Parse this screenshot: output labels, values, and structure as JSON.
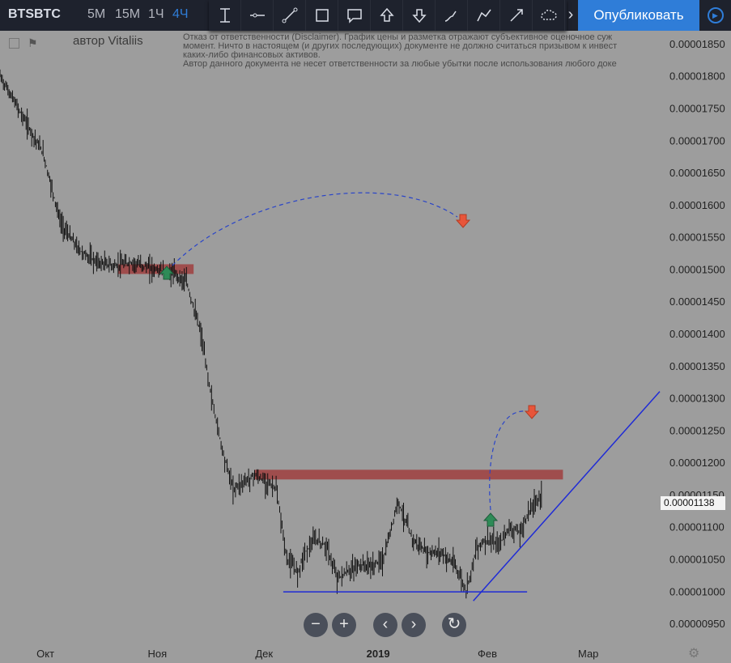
{
  "toolbar": {
    "symbol": "BTSBTC",
    "timeframes": [
      "5М",
      "15М",
      "1Ч",
      "4Ч"
    ],
    "active_timeframe": "4Ч",
    "publish_label": "Опубликовать",
    "more_label": "›"
  },
  "drawing_tools": [
    "text-cursor-icon",
    "horizontal-line-icon",
    "trend-line-icon",
    "rectangle-icon",
    "callout-icon",
    "arrow-up-icon",
    "arrow-down-icon",
    "brush-icon",
    "path-icon",
    "arrow-line-icon"
  ],
  "chart": {
    "author": "автор Vitaliis",
    "disclaimer": [
      "Отказ от ответственности (Disclaimer). График цены и разметка отражают субъективное оценочное суж",
      "момент. Ничто в настоящем (и других последующих) документе не должно считаться призывом к инвест",
      "каких-либо финансовых активов.",
      "Автор данного документа не несет ответственности за любые убытки после использования любого доке"
    ],
    "price_label": "0.00001138"
  },
  "nav_buttons": [
    "−",
    "+",
    "‹",
    "›",
    "↻"
  ],
  "colors": {
    "background": "#9d9d9d",
    "toolbar": "#1e222d",
    "accent": "#2f7dd8",
    "zone": "#a03a3a",
    "trendline": "#1f2bd6",
    "arrow_up": "#2e8b57",
    "arrow_down": "#e8553a"
  },
  "chart_data": {
    "type": "line",
    "yticks": [
      "0.00001850",
      "0.00001800",
      "0.00001750",
      "0.00001700",
      "0.00001650",
      "0.00001600",
      "0.00001550",
      "0.00001500",
      "0.00001450",
      "0.00001400",
      "0.00001350",
      "0.00001300",
      "0.00001250",
      "0.00001200",
      "0.00001150",
      "0.00001100",
      "0.00001050",
      "0.00001000",
      "0.00000950"
    ],
    "ylim": [
      9.25e-06,
      1.87e-05
    ],
    "x_labels": [
      "Окт",
      "Ноя",
      "Дек",
      "2019",
      "Фев",
      "Мар"
    ],
    "x_label_dates": [
      "2018-10-01",
      "2018-11-01",
      "2018-12-01",
      "2019-01-01",
      "2019-02-01",
      "2019-03-01"
    ],
    "xlim": [
      "2018-09-19",
      "2019-03-22"
    ],
    "series": [
      {
        "x": [
          "2018-09-19",
          "2018-09-25",
          "2018-10-01",
          "2018-10-06",
          "2018-10-11",
          "2018-10-16",
          "2018-10-21",
          "2018-10-26",
          "2018-11-01",
          "2018-11-06",
          "2018-11-10",
          "2018-11-14",
          "2018-11-17",
          "2018-11-20",
          "2018-11-23",
          "2018-11-26",
          "2018-11-29",
          "2018-12-02",
          "2018-12-05",
          "2018-12-08",
          "2018-12-11",
          "2018-12-13",
          "2018-12-16",
          "2018-12-19",
          "2018-12-22",
          "2018-12-25",
          "2018-12-28",
          "2019-01-01",
          "2019-01-04",
          "2019-01-08",
          "2019-01-12",
          "2019-01-16",
          "2019-01-20",
          "2019-01-24",
          "2019-01-27",
          "2019-01-30",
          "2019-02-02",
          "2019-02-05",
          "2019-02-08",
          "2019-02-11",
          "2019-02-14",
          "2019-02-17"
        ],
        "values": [
          1.8e-05,
          1.74e-05,
          1.68e-05,
          1.57e-05,
          1.53e-05,
          1.51e-05,
          1.505e-05,
          1.51e-05,
          1.5e-05,
          1.495e-05,
          1.48e-05,
          1.4e-05,
          1.3e-05,
          1.22e-05,
          1.16e-05,
          1.17e-05,
          1.18e-05,
          1.17e-05,
          1.16e-05,
          1.05e-05,
          1.03e-05,
          1.06e-05,
          1.08e-05,
          1.07e-05,
          1.02e-05,
          1.03e-05,
          1.04e-05,
          1.04e-05,
          1.05e-05,
          1.14e-05,
          1.08e-05,
          1.06e-05,
          1.06e-05,
          1.04e-05,
          1e-05,
          1.07e-05,
          1.08e-05,
          1.07e-05,
          1.1e-05,
          1.09e-05,
          1.13e-05,
          1.15e-05
        ]
      }
    ],
    "zones": [
      {
        "from": "2018-10-22",
        "to": "2018-11-12",
        "value": 1.5e-05
      },
      {
        "from": "2018-11-29",
        "to": "2019-02-23",
        "value": 1.181e-05
      }
    ],
    "support_line": {
      "from": "2018-12-07",
      "to": "2019-02-13",
      "value": 9.99e-06
    },
    "trend_line": {
      "from": [
        "2019-01-29",
        9.85e-06
      ],
      "to": [
        "2019-03-22",
        1.31e-05
      ]
    },
    "grid": false,
    "legend": "none"
  }
}
